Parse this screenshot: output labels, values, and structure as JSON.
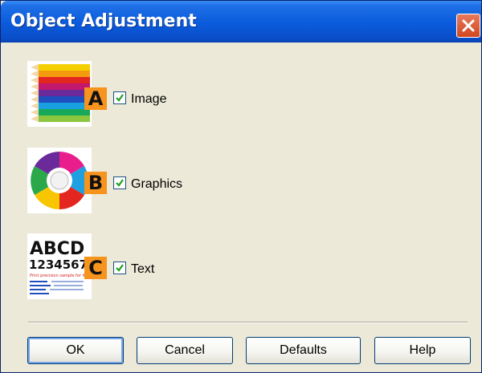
{
  "window": {
    "title": "Object Adjustment"
  },
  "rows": [
    {
      "badge": "A",
      "label": "Image",
      "checked": true,
      "thumb": "colored-pencils-image"
    },
    {
      "badge": "B",
      "label": "Graphics",
      "checked": true,
      "thumb": "color-wheel-graphic"
    },
    {
      "badge": "C",
      "label": "Text",
      "checked": true,
      "thumb": "text-sample",
      "thumb_text": {
        "line1": "ABCD",
        "line2": "1234567",
        "line3": "Print precision sample for IC"
      }
    }
  ],
  "buttons": {
    "ok": "OK",
    "cancel": "Cancel",
    "defaults": "Defaults",
    "help": "Help"
  },
  "colors": {
    "titlebar": "#0a5bdc",
    "badge": "#f7941e",
    "dialog_bg": "#ece9d8",
    "close_button": "#d2471e"
  }
}
